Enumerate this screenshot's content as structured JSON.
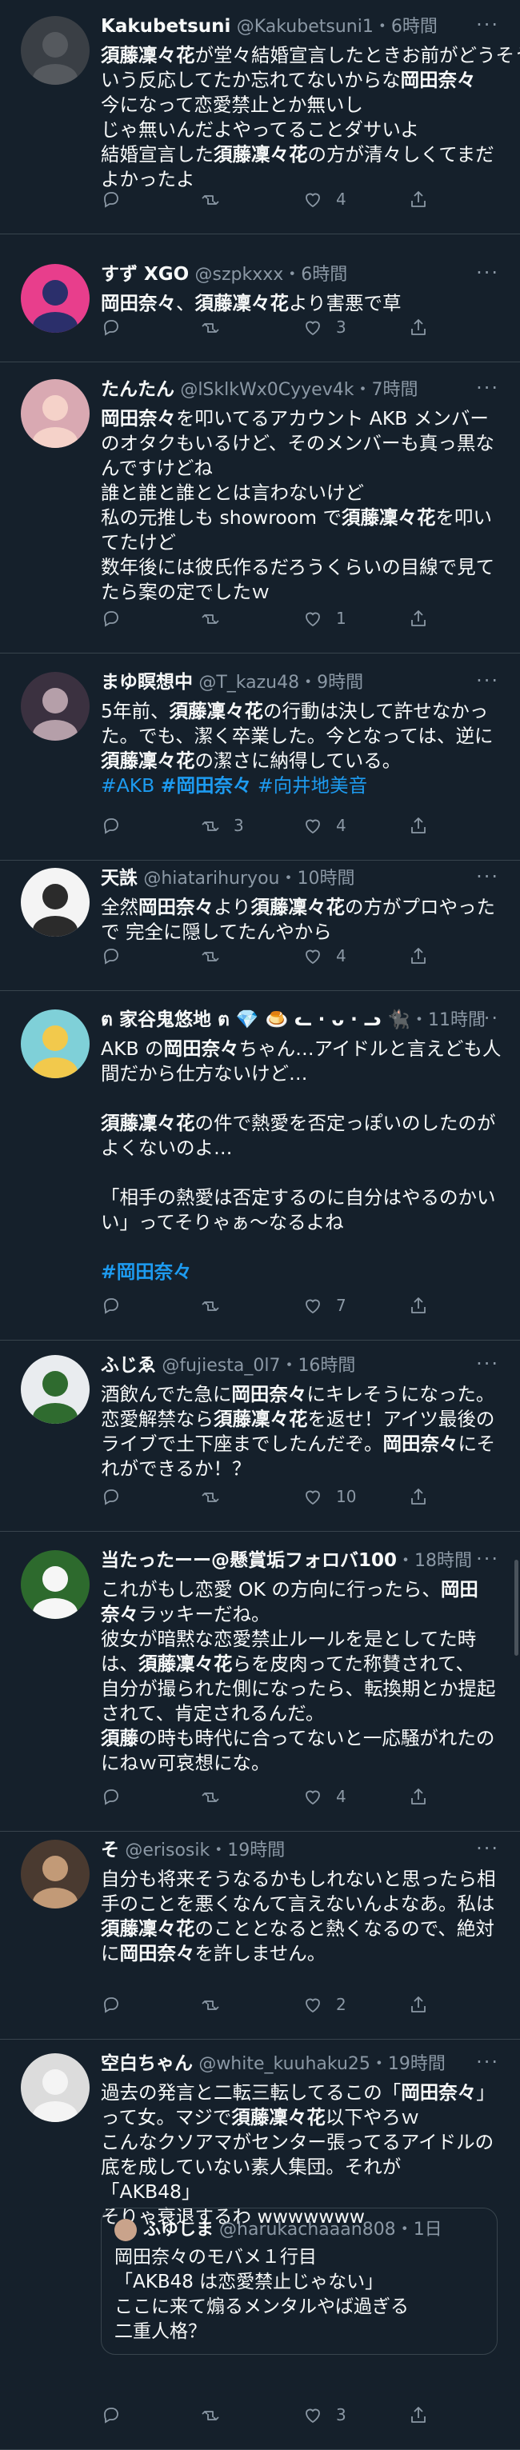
{
  "colors": {
    "background": "#15202b",
    "text": "#f7f9f9",
    "muted": "#8b98a5",
    "link": "#1d9bf0",
    "divider": "#38444d"
  },
  "icons": {
    "reply": "reply-icon",
    "retweet": "retweet-icon",
    "like": "heart-icon",
    "share": "share-icon",
    "more": "more-icon"
  },
  "tweets": [
    {
      "name": "Kakubetsuni",
      "handle": "@Kakubetsuni1",
      "time": "・6時間",
      "lines": [
        [
          {
            "t": "須藤凜々花",
            "b": true
          },
          {
            "t": "が堂々結婚宣言したときお前がどうそう"
          }
        ],
        [
          {
            "t": "いう反応してたか忘れてないからな"
          },
          {
            "t": "岡田奈々",
            "b": true
          }
        ],
        [
          {
            "t": "今になって恋愛禁止とか無いし"
          }
        ],
        [
          {
            "t": "じゃ無いんだよやってることダサいよ"
          }
        ],
        [
          {
            "t": "結婚宣言した"
          },
          {
            "t": "須藤凜々花",
            "b": true
          },
          {
            "t": "の方が清々しくてまだ"
          }
        ],
        [
          {
            "t": "よかったよ"
          }
        ]
      ],
      "counts": {
        "reply": "",
        "retweet": "",
        "like": "4",
        "share": ""
      }
    },
    {
      "name": "すず XGO",
      "handle": "@szpkxxx",
      "time": "・6時間",
      "lines": [
        [
          {
            "t": "岡田奈々",
            "b": true
          },
          {
            "t": "、"
          },
          {
            "t": "須藤凜々花",
            "b": true
          },
          {
            "t": "より害悪で草"
          }
        ]
      ],
      "counts": {
        "reply": "",
        "retweet": "",
        "like": "3",
        "share": ""
      }
    },
    {
      "name": "たんたん",
      "handle": "@lSklkWx0Cyyev4k",
      "time": "・7時間",
      "lines": [
        [
          {
            "t": "岡田奈々",
            "b": true
          },
          {
            "t": "を叩いてるアカウント AKB メンバー"
          }
        ],
        [
          {
            "t": "のオタクもいるけど、そのメンバーも真っ黒な"
          }
        ],
        [
          {
            "t": "んですけどね"
          }
        ],
        [
          {
            "t": "誰と誰と誰ととは言わないけど"
          }
        ],
        [
          {
            "t": "私の元推しも showroom で"
          },
          {
            "t": "須藤凜々花",
            "b": true
          },
          {
            "t": "を叩い"
          }
        ],
        [
          {
            "t": "てたけど"
          }
        ],
        [
          {
            "t": "数年後には彼氏作るだろうくらいの目線で見て"
          }
        ],
        [
          {
            "t": "たら案の定でしたｗ"
          }
        ]
      ],
      "counts": {
        "reply": "",
        "retweet": "",
        "like": "1",
        "share": ""
      }
    },
    {
      "name": "まゆ瞑想中",
      "handle": "@T_kazu48",
      "time": "・9時間",
      "lines": [
        [
          {
            "t": "5年前、"
          },
          {
            "t": "須藤凜々花",
            "b": true
          },
          {
            "t": "の行動は決して許せなかっ"
          }
        ],
        [
          {
            "t": "た。でも、潔く卒業した。今となっては、逆に"
          }
        ],
        [
          {
            "t": "須藤凜々花",
            "b": true
          },
          {
            "t": "の潔さに納得している。"
          }
        ],
        [
          {
            "t": "#AKB",
            "tag": true
          },
          {
            "t": " "
          },
          {
            "t": "#岡田奈々",
            "tag": true,
            "b": true
          },
          {
            "t": " "
          },
          {
            "t": "#向井地美音",
            "tag": true
          }
        ]
      ],
      "counts": {
        "reply": "",
        "retweet": "3",
        "like": "4",
        "share": ""
      }
    },
    {
      "name": "天誅",
      "handle": "@hiatarihuryou",
      "time": "・10時間",
      "lines": [
        [
          {
            "t": "全然"
          },
          {
            "t": "岡田奈々",
            "b": true
          },
          {
            "t": "より"
          },
          {
            "t": "須藤凜々花",
            "b": true
          },
          {
            "t": "の方がプロやった"
          }
        ],
        [
          {
            "t": "で 完全に隠してたんやから"
          }
        ]
      ],
      "counts": {
        "reply": "",
        "retweet": "",
        "like": "4",
        "share": ""
      }
    },
    {
      "name": "ต 家谷鬼悠地 ต 💎 🍮 ᓚ · ᴗ · ᓗ 🐈‍⬛",
      "handle": "",
      "time": "・11時間",
      "lines": [
        [
          {
            "t": "AKB の"
          },
          {
            "t": "岡田奈々",
            "b": true
          },
          {
            "t": "ちゃん…アイドルと言えども人"
          }
        ],
        [
          {
            "t": "間だから仕方ないけど…"
          }
        ],
        [],
        [
          {
            "t": "須藤凜々花",
            "b": true
          },
          {
            "t": "の件で熱愛を否定っぽいのしたのが"
          }
        ],
        [
          {
            "t": "よくないのよ…"
          }
        ],
        [],
        [
          {
            "t": "「相手の熱愛は否定するのに自分はやるのかい"
          }
        ],
        [
          {
            "t": "い」ってそりゃぁ〜なるよね"
          }
        ],
        [],
        [
          {
            "t": "#岡田奈々",
            "tag": true,
            "b": true
          }
        ]
      ],
      "counts": {
        "reply": "",
        "retweet": "",
        "like": "7",
        "share": ""
      }
    },
    {
      "name": "ふじゑ",
      "handle": "@fujiesta_0l7",
      "time": "・16時間",
      "lines": [
        [
          {
            "t": "酒飲んでた急に"
          },
          {
            "t": "岡田奈々",
            "b": true
          },
          {
            "t": "にキレそうになった。"
          }
        ],
        [
          {
            "t": "恋愛解禁なら"
          },
          {
            "t": "須藤凜々花",
            "b": true
          },
          {
            "t": "を返せ！アイツ最後の"
          }
        ],
        [
          {
            "t": "ライブで土下座までしたんだぞ。"
          },
          {
            "t": "岡田奈々",
            "b": true
          },
          {
            "t": "にそ"
          }
        ],
        [
          {
            "t": "れができるか！？"
          }
        ]
      ],
      "counts": {
        "reply": "",
        "retweet": "",
        "like": "10",
        "share": ""
      }
    },
    {
      "name": "当たったーー@懸賞垢フォロバ100",
      "handle": "",
      "time": "・18時間",
      "lines": [
        [
          {
            "t": "これがもし恋愛 OK の方向に行ったら、"
          },
          {
            "t": "岡田",
            "b": true
          }
        ],
        [
          {
            "t": "奈々",
            "b": true
          },
          {
            "t": "ラッキーだね。"
          }
        ],
        [
          {
            "t": "彼女が暗黙な恋愛禁止ルールを是としてた時"
          }
        ],
        [
          {
            "t": "は、"
          },
          {
            "t": "須藤凜々花",
            "b": true
          },
          {
            "t": "らを皮肉ってた称賛されて、"
          }
        ],
        [
          {
            "t": "自分が撮られた側になったら、転換期とか提起"
          }
        ],
        [
          {
            "t": "されて、肯定されるんだ。"
          }
        ],
        [
          {
            "t": "須藤",
            "b": true
          },
          {
            "t": "の時も時代に合ってないと一応騒がれたの"
          }
        ],
        [
          {
            "t": "にねｗ可哀想にな。"
          }
        ]
      ],
      "counts": {
        "reply": "",
        "retweet": "",
        "like": "4",
        "share": ""
      }
    },
    {
      "name": "そ",
      "handle": "@erisosik",
      "time": "・19時間",
      "lines": [
        [
          {
            "t": "自分も将来そうなるかもしれないと思ったら相"
          }
        ],
        [
          {
            "t": "手のことを悪くなんて言えないんよなあ。私は"
          }
        ],
        [
          {
            "t": "須藤凜々花",
            "b": true
          },
          {
            "t": "のこととなると熱くなるので、絶対"
          }
        ],
        [
          {
            "t": "に"
          },
          {
            "t": "岡田奈々",
            "b": true
          },
          {
            "t": "を許しません。"
          }
        ]
      ],
      "counts": {
        "reply": "",
        "retweet": "",
        "like": "2",
        "share": ""
      }
    },
    {
      "name": "空白ちゃん",
      "handle": "@white_kuuhaku25",
      "time": "・19時間",
      "lines": [
        [
          {
            "t": "過去の発言と二転三転してるこの「"
          },
          {
            "t": "岡田奈々",
            "b": true
          },
          {
            "t": "」"
          }
        ],
        [
          {
            "t": "って女。マジで"
          },
          {
            "t": "須藤凜々花",
            "b": true
          },
          {
            "t": "以下やろｗ"
          }
        ],
        [
          {
            "t": "こんなクソアマがセンター張ってるアイドルの"
          }
        ],
        [
          {
            "t": "底を成していない素人集団。それが"
          }
        ],
        [
          {
            "t": "「AKB48」"
          }
        ],
        [
          {
            "t": "そりゃ衰退するわ wwwwwww"
          }
        ]
      ],
      "quote": {
        "name": "ふゆしま",
        "handle": "@harukachaaan808",
        "time": "・1日",
        "lines": [
          "岡田奈々のモバメ１行目",
          "「AKB48 は恋愛禁止じゃない」",
          "ここに来て煽るメンタルやば過ぎる",
          "二重人格？"
        ]
      },
      "counts": {
        "reply": "",
        "retweet": "",
        "like": "3",
        "share": ""
      }
    }
  ]
}
